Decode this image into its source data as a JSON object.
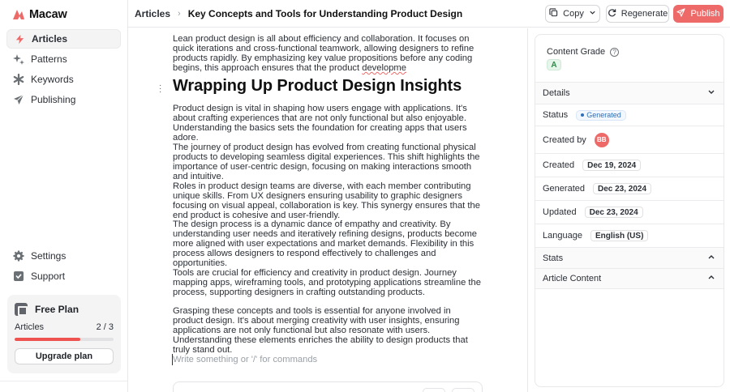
{
  "app": {
    "name": "Macaw",
    "accent": "#EE6A68"
  },
  "sidebar": {
    "items": [
      {
        "label": "Articles",
        "icon": "lightning-icon",
        "active": true
      },
      {
        "label": "Patterns",
        "icon": "sparkle-icon"
      },
      {
        "label": "Keywords",
        "icon": "asterisk-icon"
      },
      {
        "label": "Publishing",
        "icon": "send-icon"
      }
    ],
    "bottom_items": [
      {
        "label": "Settings",
        "icon": "gear-icon"
      },
      {
        "label": "Support",
        "icon": "support-icon"
      }
    ],
    "plan": {
      "title": "Free Plan",
      "metric_label": "Articles",
      "metric_value": "2 / 3",
      "progress_fraction": 0.6667,
      "upgrade_label": "Upgrade plan"
    }
  },
  "topbar": {
    "breadcrumb_root": "Articles",
    "breadcrumb_current": "Key Concepts and Tools for Understanding Product Design",
    "copy_label": "Copy",
    "regenerate_label": "Regenerate",
    "publish_label": "Publish"
  },
  "editor": {
    "intro_paragraph": "Lean product design is all about efficiency and collaboration. It focuses on quick iterations and cross-functional teamwork, allowing designers to refine products rapidly. By emphasizing key value propositions before any coding begins, this approach ensures that the product developme",
    "heading": "Wrapping Up Product Design Insights",
    "paragraphs": [
      "Product design is vital in shaping how users engage with applications. It's about crafting experiences that are not only functional but also enjoyable. Understanding the basics sets the foundation for creating apps that users adore.",
      "The journey of product design has evolved from creating functional physical products to developing seamless digital experiences. This shift highlights the importance of user-centric design, focusing on making interactions smooth and intuitive.",
      "Roles in product design teams are diverse, with each member contributing unique skills. From UX designers ensuring usability to graphic designers focusing on visual appeal, collaboration is key. This synergy ensures that the end product is cohesive and user-friendly.",
      "The design process is a dynamic dance of empathy and creativity. By understanding user needs and iteratively refining designs, products become more aligned with user expectations and market demands. Flexibility in this process allows designers to respond effectively to challenges and opportunities.",
      "Tools are crucial for efficiency and creativity in product design. Journey mapping apps, wireframing tools, and prototyping applications streamline the process, supporting designers in crafting outstanding products.",
      "Grasping these concepts and tools is essential for anyone involved in product design. It's about merging creativity with user insights, ensuring applications are not only functional but also resonate with users. Understanding these elements enriches the ability to design products that truly stand out."
    ],
    "placeholder": "Write something or '/' for commands"
  },
  "panel": {
    "content_grade_label": "Content Grade",
    "content_grade": "A",
    "details_label": "Details",
    "status_label": "Status",
    "status_value": "Generated",
    "created_by_label": "Created by",
    "created_by_initials": "BB",
    "created_label": "Created",
    "created_value": "Dec 19, 2024",
    "generated_label": "Generated",
    "generated_value": "Dec 23, 2024",
    "updated_label": "Updated",
    "updated_value": "Dec 23, 2024",
    "language_label": "Language",
    "language_value": "English (US)",
    "stats_label": "Stats",
    "article_content_label": "Article Content"
  }
}
